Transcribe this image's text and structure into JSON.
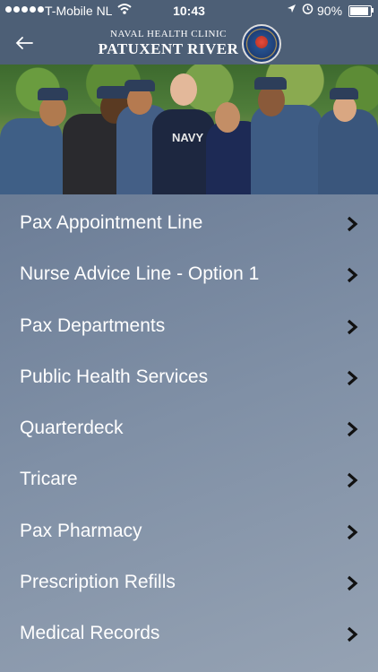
{
  "status": {
    "carrier": "T-Mobile NL",
    "time": "10:43",
    "battery": "90%",
    "battery_level": 0.9
  },
  "header": {
    "clinic_line1": "NAVAL HEALTH CLINIC",
    "clinic_line2": "PATUXENT RIVER",
    "back_icon": "arrow-left-icon",
    "seal_icon": "clinic-seal-logo"
  },
  "menu": {
    "items": [
      {
        "label": "Pax Appointment Line"
      },
      {
        "label": "Nurse Advice Line - Option 1"
      },
      {
        "label": "Pax Departments"
      },
      {
        "label": "Public Health Services"
      },
      {
        "label": "Quarterdeck"
      },
      {
        "label": "Tricare"
      },
      {
        "label": "Pax Pharmacy"
      },
      {
        "label": "Prescription Refills"
      },
      {
        "label": "Medical Records"
      }
    ]
  },
  "photo": {
    "shirt_text": "NAVY"
  }
}
